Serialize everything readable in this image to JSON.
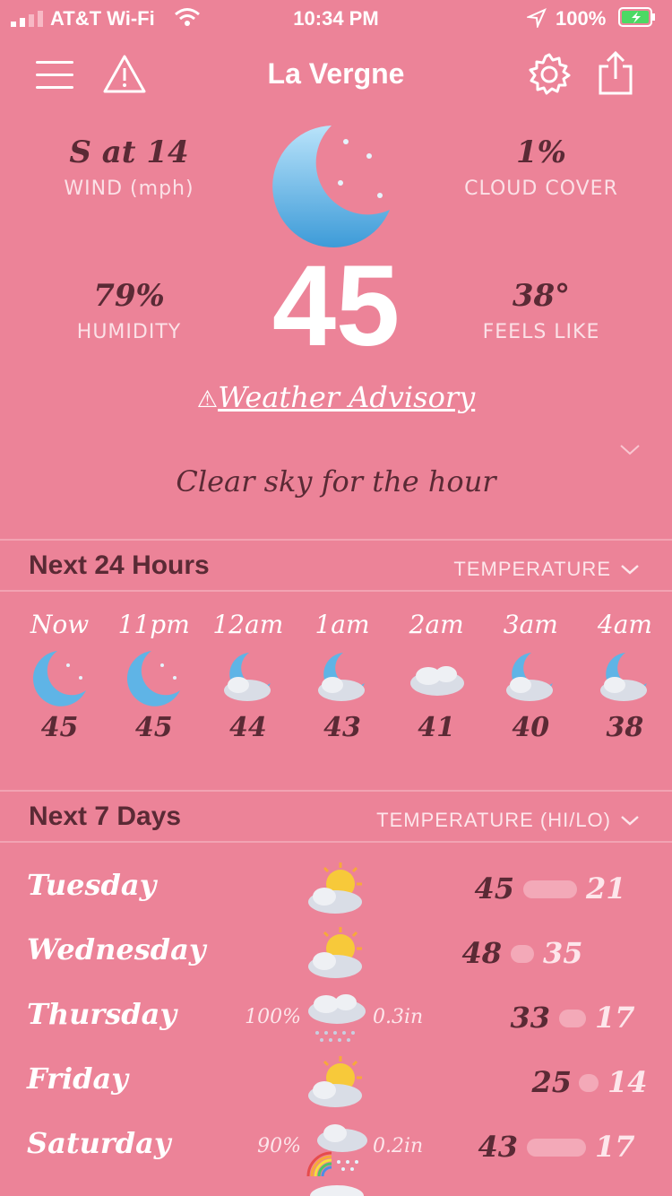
{
  "status": {
    "carrier": "AT&T Wi-Fi",
    "time": "10:34 PM",
    "battery": "100%"
  },
  "header": {
    "city": "La Vergne"
  },
  "current": {
    "wind": {
      "value": "S at 14",
      "label": "WIND (mph)"
    },
    "cloud": {
      "value": "1%",
      "label": "CLOUD COVER"
    },
    "humidity": {
      "value": "79%",
      "label": "HUMIDITY"
    },
    "feels": {
      "value": "38°",
      "label": "FEELS LIKE"
    },
    "temp": "45",
    "advisory_icon": "⚠",
    "advisory": "Weather Advisory",
    "summary": "Clear sky for the hour"
  },
  "hours_section": {
    "title": "Next 24 Hours",
    "selector": "TEMPERATURE"
  },
  "hours": [
    {
      "label": "Now",
      "temp": "45",
      "icon": "moon-icon"
    },
    {
      "label": "11pm",
      "temp": "45",
      "icon": "moon-icon"
    },
    {
      "label": "12am",
      "temp": "44",
      "icon": "moon-cloud-icon"
    },
    {
      "label": "1am",
      "temp": "43",
      "icon": "moon-cloud-icon"
    },
    {
      "label": "2am",
      "temp": "41",
      "icon": "cloud-icon"
    },
    {
      "label": "3am",
      "temp": "40",
      "icon": "moon-cloud-icon"
    },
    {
      "label": "4am",
      "temp": "38",
      "icon": "moon-cloud-icon"
    }
  ],
  "days_section": {
    "title": "Next 7 Days",
    "selector": "TEMPERATURE (HI/LO)"
  },
  "days": [
    {
      "name": "Tuesday",
      "pct": "",
      "amt": "",
      "hi": "45",
      "lo": "21",
      "icon": "sun-cloud-icon"
    },
    {
      "name": "Wednesday",
      "pct": "",
      "amt": "",
      "hi": "48",
      "lo": "35",
      "icon": "sun-cloud-icon"
    },
    {
      "name": "Thursday",
      "pct": "100%",
      "amt": "0.3in",
      "hi": "33",
      "lo": "17",
      "icon": "snow-cloud-icon"
    },
    {
      "name": "Friday",
      "pct": "",
      "amt": "",
      "hi": "25",
      "lo": "14",
      "icon": "sun-cloud-icon"
    },
    {
      "name": "Saturday",
      "pct": "90%",
      "amt": "0.2in",
      "hi": "43",
      "lo": "17",
      "icon": "rainbow-cloud-icon"
    }
  ],
  "colors": {
    "background": "#ec8398",
    "text_dark": "#5a2a35",
    "text_light": "#fde6eb"
  }
}
